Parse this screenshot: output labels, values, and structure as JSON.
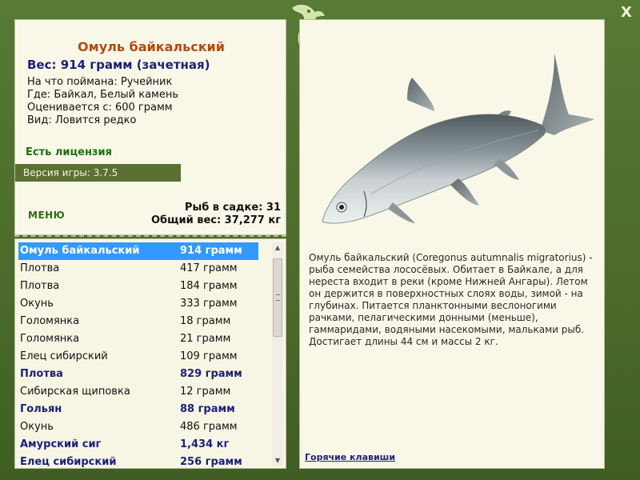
{
  "window": {
    "close_label": "X",
    "accent_color": "#587a34"
  },
  "info": {
    "title": "Омуль байкальский",
    "weight_line": "Вес: 914 грамм (зачетная)",
    "details": [
      "На что поймана: Ручейник",
      "Где: Байкал, Белый камень",
      "Оценивается с: 600 грамм",
      "Вид: Ловится редко"
    ],
    "license": "Есть лицензия",
    "version": "Версия игры: 3.7.5",
    "menu_label": "Меню",
    "fish_count": "Рыб в садке: 31",
    "total_weight": "Общий вес: 37,277 кг"
  },
  "catch_list": [
    {
      "name": "Омуль байкальский",
      "weight": "914 грамм",
      "state": "selected"
    },
    {
      "name": "Плотва",
      "weight": "417 грамм",
      "state": "normal"
    },
    {
      "name": "Плотва",
      "weight": "184 грамм",
      "state": "normal"
    },
    {
      "name": "Окунь",
      "weight": "333 грамм",
      "state": "normal"
    },
    {
      "name": "Голомянка",
      "weight": "18 грамм",
      "state": "normal"
    },
    {
      "name": "Голомянка",
      "weight": "21 грамм",
      "state": "normal"
    },
    {
      "name": "Елец сибирский",
      "weight": "109 грамм",
      "state": "normal"
    },
    {
      "name": "Плотва",
      "weight": "829 грамм",
      "state": "bold"
    },
    {
      "name": "Сибирская щиповка",
      "weight": "12 грамм",
      "state": "normal"
    },
    {
      "name": "Гольян",
      "weight": "88 грамм",
      "state": "bold"
    },
    {
      "name": "Окунь",
      "weight": "486 грамм",
      "state": "normal"
    },
    {
      "name": "Амурский сиг",
      "weight": "1,434 кг",
      "state": "bold"
    },
    {
      "name": "Елец сибирский",
      "weight": "256 грамм",
      "state": "bold"
    }
  ],
  "scrollbar": {
    "up_icon": "triangle-up-icon",
    "down_icon": "triangle-down-icon"
  },
  "detail": {
    "image_icon": "omul-fish-image",
    "description": "Омуль байкальский (Coregonus autumnalis migratorius) - рыба семейства лососёвых. Обитает в Байкале, а для нереста входит в реки (кроме Нижней Ангары). Летом он держится в поверхностных слоях воды, зимой - на глубинах. Питается планктонными веслоногими рачками, пелагическими донными (меньше), гаммаридами, водяными насекомыми, мальками рыб. Достигает длины 44 см и массы 2 кг.",
    "hotkeys_link": "Горячие клавиши"
  }
}
